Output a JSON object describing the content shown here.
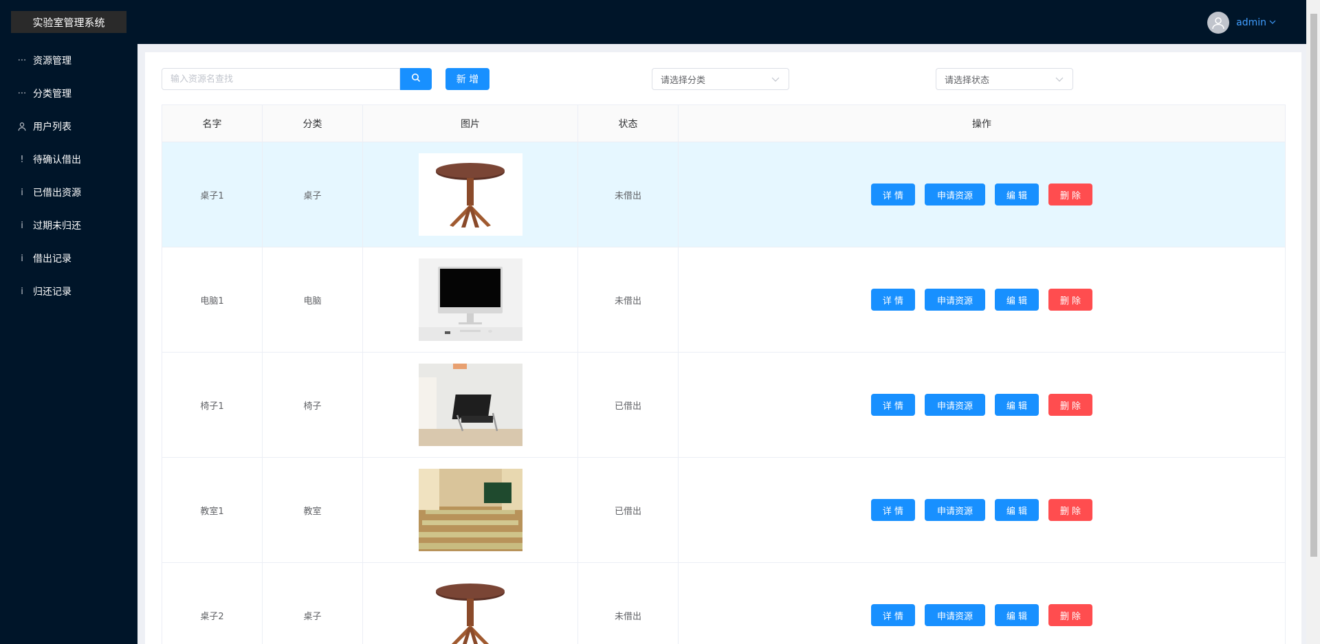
{
  "app": {
    "title": "实验室管理系统"
  },
  "sidebar": {
    "items": [
      {
        "label": "资源管理",
        "icon": "dots-icon"
      },
      {
        "label": "分类管理",
        "icon": "dots-icon"
      },
      {
        "label": "用户列表",
        "icon": "user-icon"
      },
      {
        "label": "待确认借出",
        "icon": "exclamation-icon"
      },
      {
        "label": "已借出资源",
        "icon": "info-icon"
      },
      {
        "label": "过期未归还",
        "icon": "info-icon"
      },
      {
        "label": "借出记录",
        "icon": "info-icon"
      },
      {
        "label": "归还记录",
        "icon": "info-icon"
      }
    ]
  },
  "header": {
    "username": "admin"
  },
  "toolbar": {
    "search_placeholder": "输入资源名查找",
    "add_label": "新 增",
    "category_placeholder": "请选择分类",
    "status_placeholder": "请选择状态"
  },
  "table": {
    "columns": [
      "名字",
      "分类",
      "图片",
      "状态",
      "操作"
    ],
    "rows": [
      {
        "name": "桌子1",
        "category": "桌子",
        "image": "table-image",
        "status": "未借出"
      },
      {
        "name": "电脑1",
        "category": "电脑",
        "image": "computer-image",
        "status": "未借出"
      },
      {
        "name": "椅子1",
        "category": "椅子",
        "image": "chair-image",
        "status": "已借出"
      },
      {
        "name": "教室1",
        "category": "教室",
        "image": "classroom-image",
        "status": "已借出"
      },
      {
        "name": "桌子2",
        "category": "桌子",
        "image": "table-image",
        "status": "未借出"
      }
    ],
    "actions": {
      "detail": "详 情",
      "apply": "申请资源",
      "edit": "编 辑",
      "delete": "删 除"
    }
  },
  "colors": {
    "sidebar_bg": "#001529",
    "primary": "#1890ff",
    "danger": "#ff4d4f",
    "highlight_row": "#e6f7ff"
  }
}
